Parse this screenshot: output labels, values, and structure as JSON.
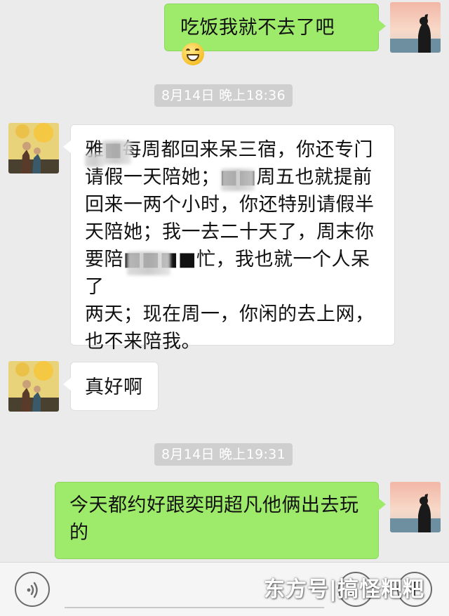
{
  "messages": [
    {
      "side": "sent",
      "text": "吃饭我就不去了吧"
    },
    {
      "side": "received",
      "text": "雅■每周都回来呆三宿，你还专门\n请假一天陪她；■■周五也就提前\n回来一两个小时，你还特别请假半\n天陪她；我一去二十天了，周末你\n要陪■■■■忙，我也就一个人呆了\n两天；现在周一，你闲的去上网，\n也不来陪我。"
    },
    {
      "side": "received",
      "text": "真好啊"
    },
    {
      "side": "sent",
      "text": "今天都约好跟奕明超凡他俩出去玩\n的"
    }
  ],
  "timestamps": [
    "8月14日 晚上18:36",
    "8月14日 晚上19:31"
  ],
  "watermark": "东方号|搞怪粑粑",
  "colors": {
    "background": "#ebebeb",
    "sent_bubble": "#9eea6a",
    "received_bubble": "#ffffff",
    "timestamp_bg": "#cfcfcf"
  },
  "icons": {
    "voice": "voice-icon",
    "emoji": "emoji-icon",
    "plus": "plus-icon",
    "inline_emoji": "grinning-face-emoji"
  }
}
